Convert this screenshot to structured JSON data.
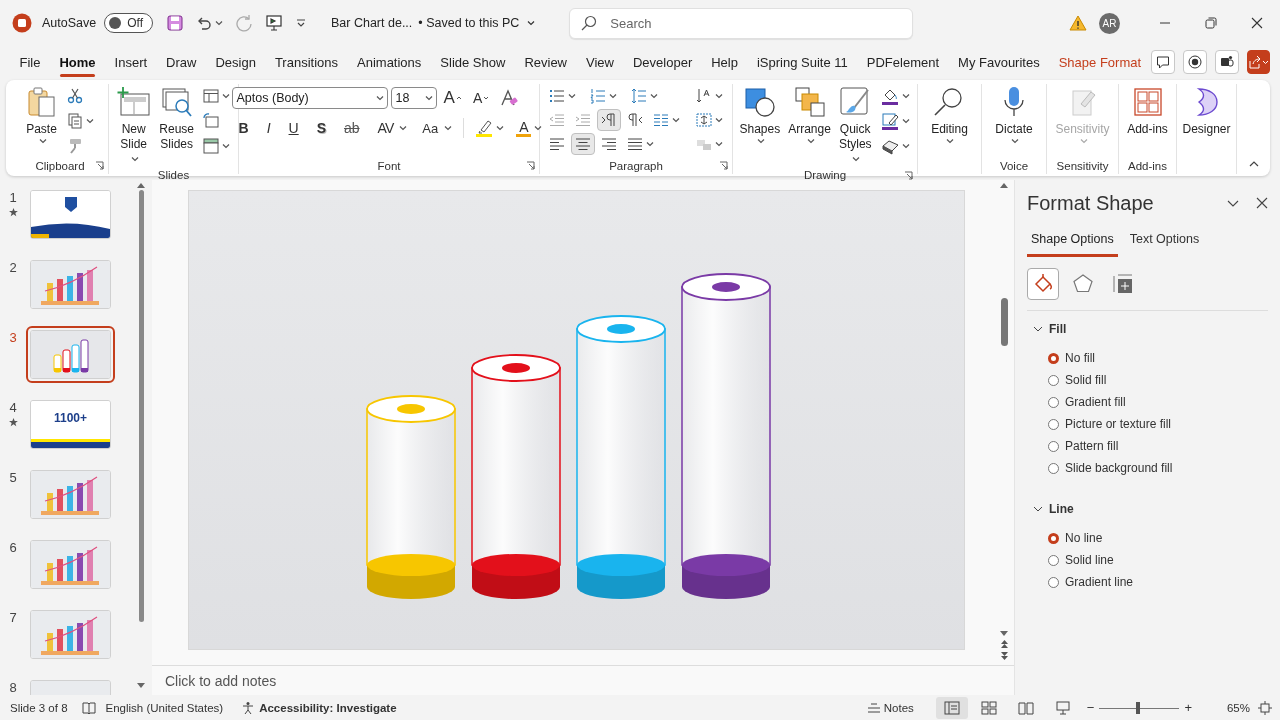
{
  "titlebar": {
    "autosave_label": "AutoSave",
    "autosave": {
      "on": false,
      "label": "Off"
    },
    "document_title": "Bar Chart de...",
    "save_status": "• Saved to this PC",
    "search": {
      "placeholder": "Search"
    },
    "avatar": "AR"
  },
  "menu_tabs": [
    {
      "label": "File",
      "selected": false,
      "contextual": false
    },
    {
      "label": "Home",
      "selected": true,
      "contextual": false
    },
    {
      "label": "Insert",
      "selected": false,
      "contextual": false
    },
    {
      "label": "Draw",
      "selected": false,
      "contextual": false
    },
    {
      "label": "Design",
      "selected": false,
      "contextual": false
    },
    {
      "label": "Transitions",
      "selected": false,
      "contextual": false
    },
    {
      "label": "Animations",
      "selected": false,
      "contextual": false
    },
    {
      "label": "Slide Show",
      "selected": false,
      "contextual": false
    },
    {
      "label": "Review",
      "selected": false,
      "contextual": false
    },
    {
      "label": "View",
      "selected": false,
      "contextual": false
    },
    {
      "label": "Developer",
      "selected": false,
      "contextual": false
    },
    {
      "label": "Help",
      "selected": false,
      "contextual": false
    },
    {
      "label": "iSpring Suite 11",
      "selected": false,
      "contextual": false
    },
    {
      "label": "PDFelement",
      "selected": false,
      "contextual": false
    },
    {
      "label": "My Favourites",
      "selected": false,
      "contextual": false
    },
    {
      "label": "Shape Format",
      "selected": false,
      "contextual": true
    }
  ],
  "ribbon": {
    "clipboard": {
      "label": "Clipboard",
      "paste": "Paste"
    },
    "slides": {
      "label": "Slides",
      "new_slide": "New Slide",
      "reuse_slides": "Reuse Slides"
    },
    "font": {
      "label": "Font",
      "font_name": "Aptos (Body)",
      "font_size": "18",
      "grow": "A",
      "shrink": "A",
      "format_buttons": [
        "B",
        "I",
        "U",
        "S",
        "ab",
        "AV",
        "Aa"
      ],
      "font_color": "A"
    },
    "paragraph": {
      "label": "Paragraph",
      "direction": [
        {
          "selected": true
        },
        {
          "selected": false
        }
      ],
      "alignment": [
        {
          "selected": false
        },
        {
          "selected": true
        },
        {
          "selected": false
        },
        {
          "selected": false
        }
      ]
    },
    "drawing": {
      "label": "Drawing",
      "shapes": "Shapes",
      "arrange": "Arrange",
      "quick_styles": "Quick Styles"
    },
    "editing": {
      "button": "Editing"
    },
    "voice": {
      "label": "Voice",
      "dictate": "Dictate"
    },
    "sensitivity": {
      "label": "Sensitivity",
      "button": "Sensitivity",
      "disabled": true
    },
    "add_ins": {
      "label": "Add-ins",
      "button": "Add-ins"
    },
    "designer": {
      "button": "Designer"
    }
  },
  "slides": [
    {
      "number": "1",
      "starred": true,
      "selected": false,
      "kind": "title"
    },
    {
      "number": "2",
      "starred": false,
      "selected": false,
      "kind": "chart"
    },
    {
      "number": "3",
      "starred": false,
      "selected": true,
      "kind": "cylinders"
    },
    {
      "number": "4",
      "starred": true,
      "selected": false,
      "kind": "promo",
      "text": "1100+"
    },
    {
      "number": "5",
      "starred": false,
      "selected": false,
      "kind": "chart"
    },
    {
      "number": "6",
      "starred": false,
      "selected": false,
      "kind": "chart"
    },
    {
      "number": "7",
      "starred": false,
      "selected": false,
      "kind": "chart"
    },
    {
      "number": "8",
      "starred": false,
      "selected": false,
      "kind": "blank"
    }
  ],
  "slide": {
    "cylinders": [
      {
        "color": "#f7c600"
      },
      {
        "color": "#e3101b"
      },
      {
        "color": "#19b4ee"
      },
      {
        "color": "#7a3aa6"
      }
    ]
  },
  "notes": {
    "placeholder": "Click to add notes"
  },
  "format_pane": {
    "title": "Format Shape",
    "tabs": [
      {
        "label": "Shape Options",
        "selected": true
      },
      {
        "label": "Text Options",
        "selected": false
      }
    ],
    "icon_tabs": [
      {
        "selected": true
      },
      {
        "selected": false
      },
      {
        "selected": false
      }
    ],
    "sections": [
      {
        "label": "Fill",
        "expanded": true,
        "options": [
          {
            "label": "No fill",
            "selected": true
          },
          {
            "label": "Solid fill",
            "selected": false
          },
          {
            "label": "Gradient fill",
            "selected": false
          },
          {
            "label": "Picture or texture fill",
            "selected": false
          },
          {
            "label": "Pattern fill",
            "selected": false
          },
          {
            "label": "Slide background fill",
            "selected": false
          }
        ]
      },
      {
        "label": "Line",
        "expanded": true,
        "options": [
          {
            "label": "No line",
            "selected": true
          },
          {
            "label": "Solid line",
            "selected": false
          },
          {
            "label": "Gradient line",
            "selected": false
          }
        ]
      }
    ]
  },
  "status_bar": {
    "slide_info": "Slide 3 of 8",
    "language": "English (United States)",
    "accessibility": "Accessibility: Investigate",
    "notes": "Notes",
    "views": [
      {
        "selected": true
      },
      {
        "selected": false
      },
      {
        "selected": false
      },
      {
        "selected": false
      }
    ],
    "zoom_out": "−",
    "zoom": {
      "level": 0.48
    },
    "zoom_in": "+",
    "zoom_reading": "65%"
  }
}
